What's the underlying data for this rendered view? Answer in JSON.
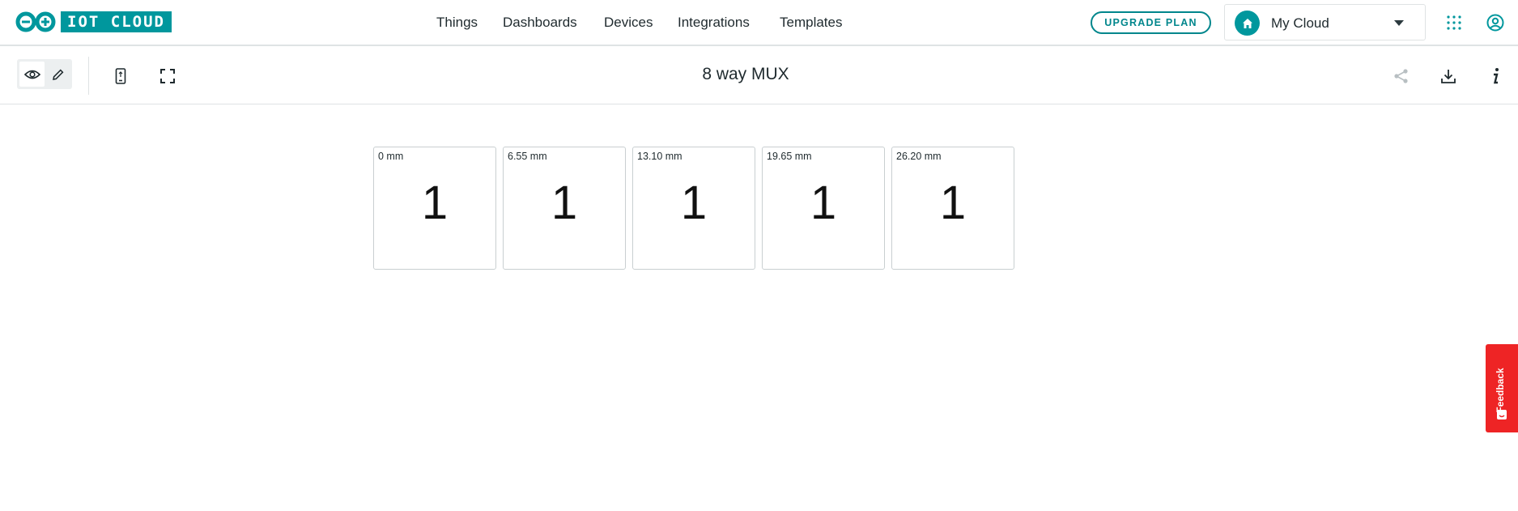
{
  "brand": {
    "logo_text": "IOT CLOUD",
    "accent": "#00979d"
  },
  "nav": {
    "items": [
      {
        "label": "Things"
      },
      {
        "label": "Dashboards"
      },
      {
        "label": "Devices"
      },
      {
        "label": "Integrations"
      },
      {
        "label": "Templates"
      }
    ],
    "upgrade_label": "UPGRADE PLAN",
    "cloud_label": "My Cloud"
  },
  "toolbar": {
    "title": "8 way MUX",
    "mode": "view"
  },
  "widgets": [
    {
      "title": "0 mm",
      "value": "1"
    },
    {
      "title": "6.55 mm",
      "value": "1"
    },
    {
      "title": "13.10 mm",
      "value": "1"
    },
    {
      "title": "19.65 mm",
      "value": "1"
    },
    {
      "title": "26.20 mm",
      "value": "1"
    }
  ],
  "feedback": {
    "label": "Feedback",
    "color": "#ee2425"
  }
}
